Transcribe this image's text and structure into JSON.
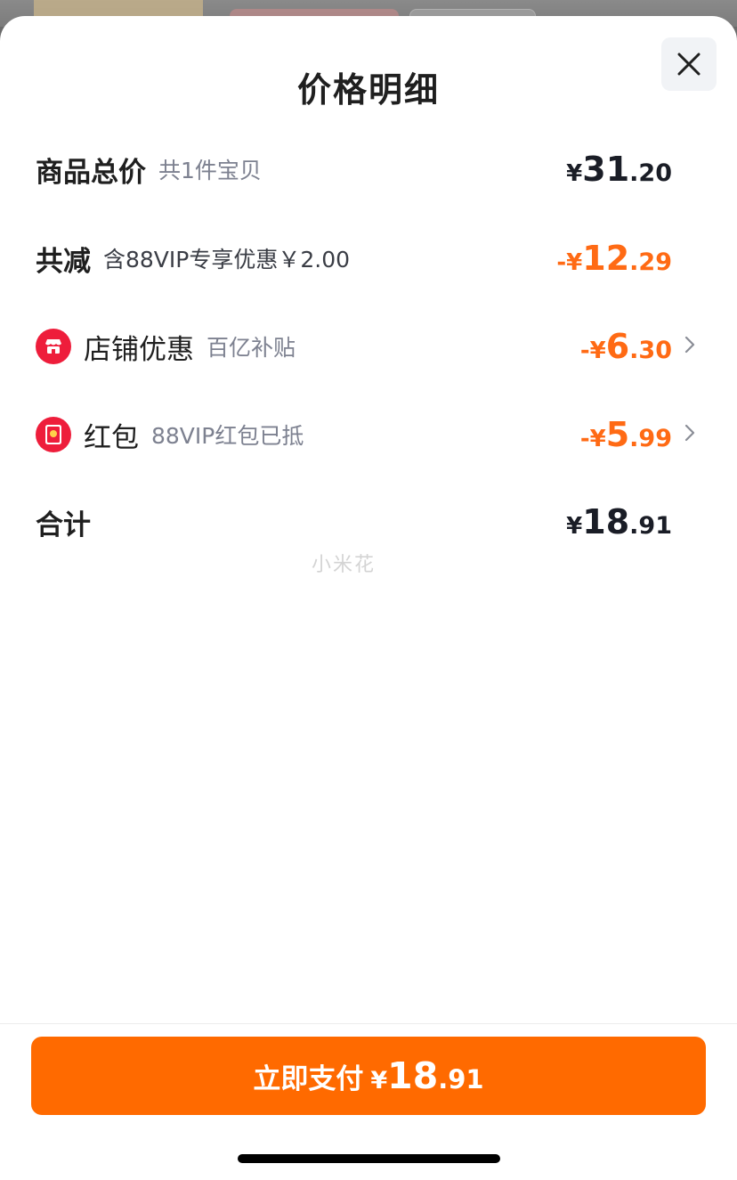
{
  "title": "价格明细",
  "rows": {
    "total": {
      "label": "商品总价",
      "sub": "共1件宝贝",
      "yen": "¥",
      "int": "31",
      "dec": ".20"
    },
    "reduce": {
      "label": "共减",
      "sub": "含88VIP专享优惠￥2.00",
      "prefix": "-¥",
      "int": "12",
      "dec": ".29"
    },
    "shop": {
      "label": "店铺优惠",
      "sub": "百亿补贴",
      "prefix": "-¥",
      "int": "6",
      "dec": ".30",
      "icon": "store-icon"
    },
    "redpacket": {
      "label": "红包",
      "sub": "88VIP红包已抵",
      "prefix": "-¥",
      "int": "5",
      "dec": ".99",
      "icon": "red-packet-icon"
    },
    "sum": {
      "label": "合计",
      "yen": "¥",
      "int": "18",
      "dec": ".91"
    }
  },
  "watermark": "小米花",
  "pay_button": {
    "label": "立即支付",
    "yen": "¥",
    "int": "18",
    "dec": ".91"
  },
  "colors": {
    "accent": "#ff6a00",
    "discount": "#ff6a14",
    "badge_red": "#ee1d3b"
  }
}
